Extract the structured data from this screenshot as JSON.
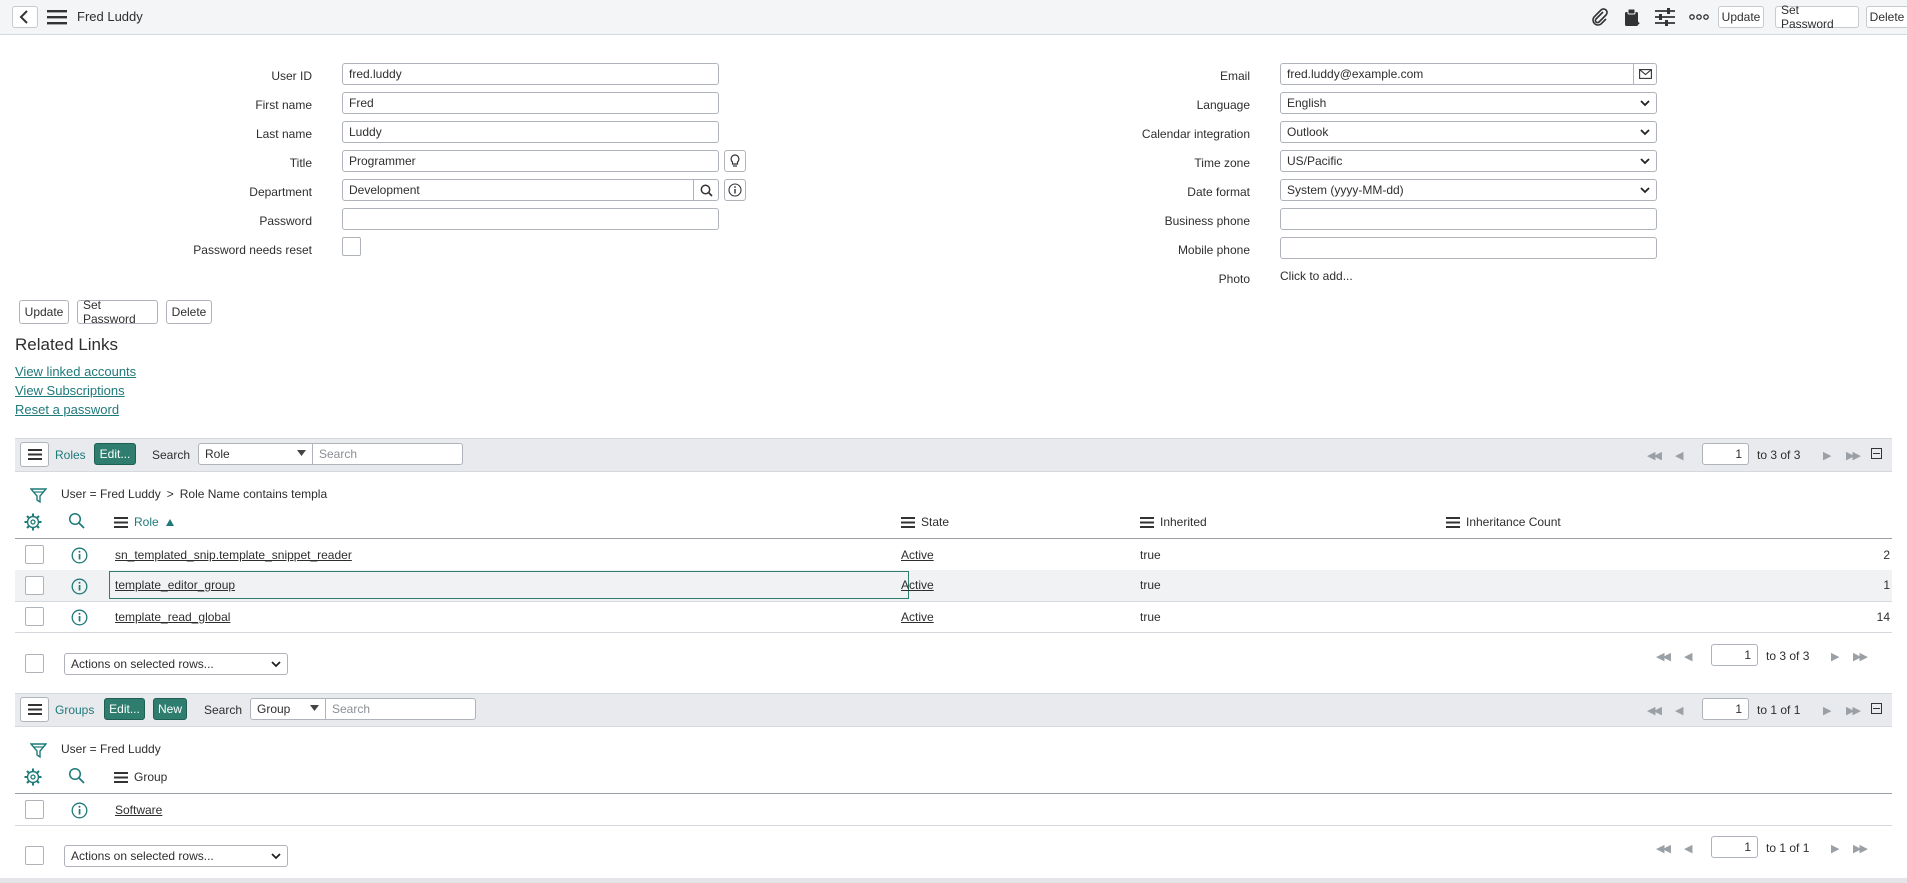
{
  "header": {
    "title": "Fred Luddy",
    "update_label": "Update",
    "set_password_label": "Set Password",
    "delete_label": "Delete"
  },
  "form": {
    "left": {
      "user_id": {
        "label": "User ID",
        "value": "fred.luddy"
      },
      "first_name": {
        "label": "First name",
        "value": "Fred"
      },
      "last_name": {
        "label": "Last name",
        "value": "Luddy"
      },
      "title": {
        "label": "Title",
        "value": "Programmer"
      },
      "department": {
        "label": "Department",
        "value": "Development"
      },
      "password": {
        "label": "Password",
        "value": ""
      },
      "password_needs_reset": {
        "label": "Password needs reset"
      }
    },
    "right": {
      "email": {
        "label": "Email",
        "value": "fred.luddy@example.com"
      },
      "language": {
        "label": "Language",
        "value": "English"
      },
      "calendar_integration": {
        "label": "Calendar integration",
        "value": "Outlook"
      },
      "time_zone": {
        "label": "Time zone",
        "value": "US/Pacific"
      },
      "date_format": {
        "label": "Date format",
        "value": "System (yyyy-MM-dd)"
      },
      "business_phone": {
        "label": "Business phone",
        "value": ""
      },
      "mobile_phone": {
        "label": "Mobile phone",
        "value": ""
      },
      "photo": {
        "label": "Photo",
        "value": "Click to add..."
      }
    },
    "buttons": {
      "update": "Update",
      "set_password": "Set Password",
      "delete": "Delete"
    }
  },
  "related_links": {
    "title": "Related Links",
    "items": [
      "View linked accounts",
      "View Subscriptions",
      "Reset a password"
    ]
  },
  "roles_list": {
    "tab": "Roles",
    "edit": "Edit...",
    "search_label": "Search",
    "search_field": "Role",
    "search_placeholder": "Search",
    "page": "1",
    "range": "to 3 of 3",
    "breadcrumb": {
      "part1": "User = Fred Luddy",
      "sep": ">",
      "part2": "Role Name contains templa"
    },
    "columns": {
      "role": "Role",
      "state": "State",
      "inherited": "Inherited",
      "count": "Inheritance Count"
    },
    "rows": [
      {
        "role": "sn_templated_snip.template_snippet_reader",
        "state": "Active",
        "inherited": "true",
        "count": "2"
      },
      {
        "role": "template_editor_group",
        "state": "Active",
        "inherited": "true",
        "count": "1"
      },
      {
        "role": "template_read_global",
        "state": "Active",
        "inherited": "true",
        "count": "14"
      }
    ],
    "actions": "Actions on selected rows...",
    "footer_page": "1",
    "footer_range": "to 3 of 3"
  },
  "groups_list": {
    "tab": "Groups",
    "edit": "Edit...",
    "new": "New",
    "search_label": "Search",
    "search_field": "Group",
    "search_placeholder": "Search",
    "page": "1",
    "range": "to 1 of 1",
    "breadcrumb": "User = Fred Luddy",
    "columns": {
      "group": "Group"
    },
    "rows": [
      {
        "group": "Software"
      }
    ],
    "actions": "Actions on selected rows...",
    "footer_page": "1",
    "footer_range": "to 1 of 1"
  },
  "colors": {
    "accent": "#2e7d6f",
    "link": "#1f7a7a",
    "header_bg": "#f4f5f6",
    "list_header_bg": "#e8eaed"
  }
}
